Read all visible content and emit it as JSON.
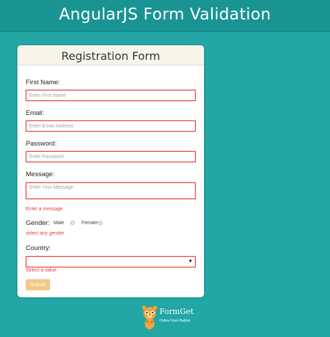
{
  "banner": {
    "title": "AngularJS Form Validation"
  },
  "form": {
    "title": "Registration Form",
    "first_name": {
      "label": "First Name:",
      "placeholder": "Enter First Name"
    },
    "email": {
      "label": "Email:",
      "placeholder": "Enter Email Address"
    },
    "password": {
      "label": "Password:",
      "placeholder": "Enter Password"
    },
    "message": {
      "label": "Message:",
      "placeholder": "Enter Your Message",
      "error": "Enter a message"
    },
    "gender": {
      "label": "Gender:",
      "options": [
        "Male",
        "Female"
      ],
      "error": "select any gender"
    },
    "country": {
      "label": "Country:",
      "selected": "",
      "error": "Select a value"
    },
    "submit_label": "Submit"
  },
  "logo": {
    "name": "FormGet",
    "tagline": "Online Form Builder"
  },
  "colors": {
    "background": "#22a6a6",
    "banner": "#1a9393",
    "error": "#e83a3a",
    "submit": "#f0c987"
  }
}
